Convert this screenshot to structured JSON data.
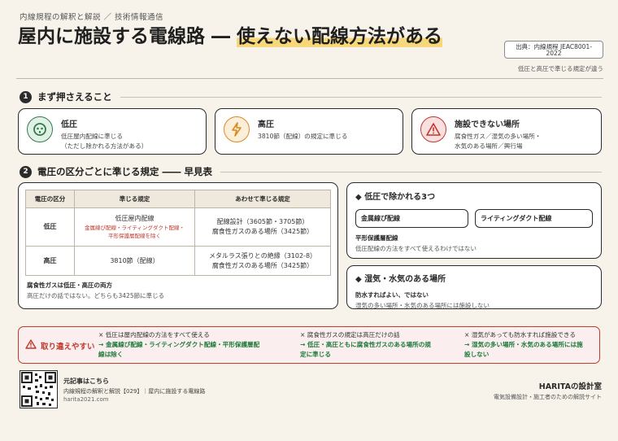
{
  "header": {
    "eyebrow": "内線規程の解釈と解説 ／ 技術情報通信",
    "title_part1": "屋内に施設する電線路 ― ",
    "title_part2": "使えない配線方法がある",
    "source": "出典：内線規程 JEAC8001-2022",
    "source_note": "低圧と高圧で準じる規定が違う"
  },
  "section1": {
    "num": "1",
    "title": "まず押さえること",
    "cards": [
      {
        "title": "低圧",
        "line1": "低圧屋内配線に準じる",
        "line2": "（ただし除かれる方法がある）",
        "icon": "plug-icon",
        "color": "#2e7d4f"
      },
      {
        "title": "高圧",
        "line1": "3810節（配線）の規定に準じる",
        "line2": "",
        "icon": "lightning-icon",
        "color": "#d98a1f"
      },
      {
        "title": "施設できない場所",
        "line1": "腐食性ガス／湿気の多い場所・",
        "line2": "水気のある場所／興行場",
        "icon": "warning-icon",
        "color": "#c0392b"
      }
    ]
  },
  "section2": {
    "num": "2",
    "title": "電圧の区分ごとに準じる規定 ―― 早見表",
    "table": {
      "headers": [
        "電圧の区分",
        "準じる規定",
        "あわせて準じる規定"
      ],
      "rows": [
        {
          "kind": "低圧",
          "rule_main": "低圧屋内配線",
          "rule_note1": "金属線ぴ配線・ライティングダクト配線・",
          "rule_note2": "平形保護層配線を除く",
          "also1": "配線設計（3605節・3705節）",
          "also2": "腐食性ガスのある場所（3425節）"
        },
        {
          "kind": "高圧",
          "rule_main": "3810節（配線）",
          "rule_note1": "",
          "rule_note2": "",
          "also1": "メタルラス張りとの絶縁（3102-8）",
          "also2": "腐食性ガスのある場所（3425節）"
        }
      ],
      "note_title": "腐食性ガスは低圧・高圧の両方",
      "note_text": "高圧だけの話ではない。どちらも3425節に準じる"
    },
    "excluded": {
      "title": "低圧で除かれる3つ",
      "item1": "金属線ぴ配線",
      "item2": "ライティングダクト配線",
      "item3_title": "平形保護層配線",
      "item3_text": "低圧配線の方法をすべて使えるわけではない"
    },
    "wet": {
      "title": "湿気・水気のある場所",
      "sub": "防水すればよい、ではない",
      "text": "湿気の多い場所・水気のある場所には施設しない"
    }
  },
  "warning": {
    "label": "取り違えやすい",
    "items": [
      {
        "wrong": "× 低圧は屋内配線の方法をすべて使える",
        "right1": "→ 金属線ぴ配線・ライティングダクト配線・平形保護層配",
        "right2": "線は除く"
      },
      {
        "wrong": "× 腐食性ガスの規定は高圧だけの話",
        "right1": "→ 低圧・高圧ともに腐食性ガスのある場所の規",
        "right2": "定に準じる"
      },
      {
        "wrong": "× 湿気があっても防水すれば施設できる",
        "right1": "→ 湿気の多い場所・水気のある場所には施",
        "right2": "設しない"
      }
    ]
  },
  "footer": {
    "original": "元記事はこちら",
    "article": "内線規程の解釈と解説【029】｜屋内に施設する電線路",
    "url": "harita2021.com",
    "brand": "HARITAの設計室",
    "tagline": "電気設備設計・施工者のための解説サイト"
  }
}
